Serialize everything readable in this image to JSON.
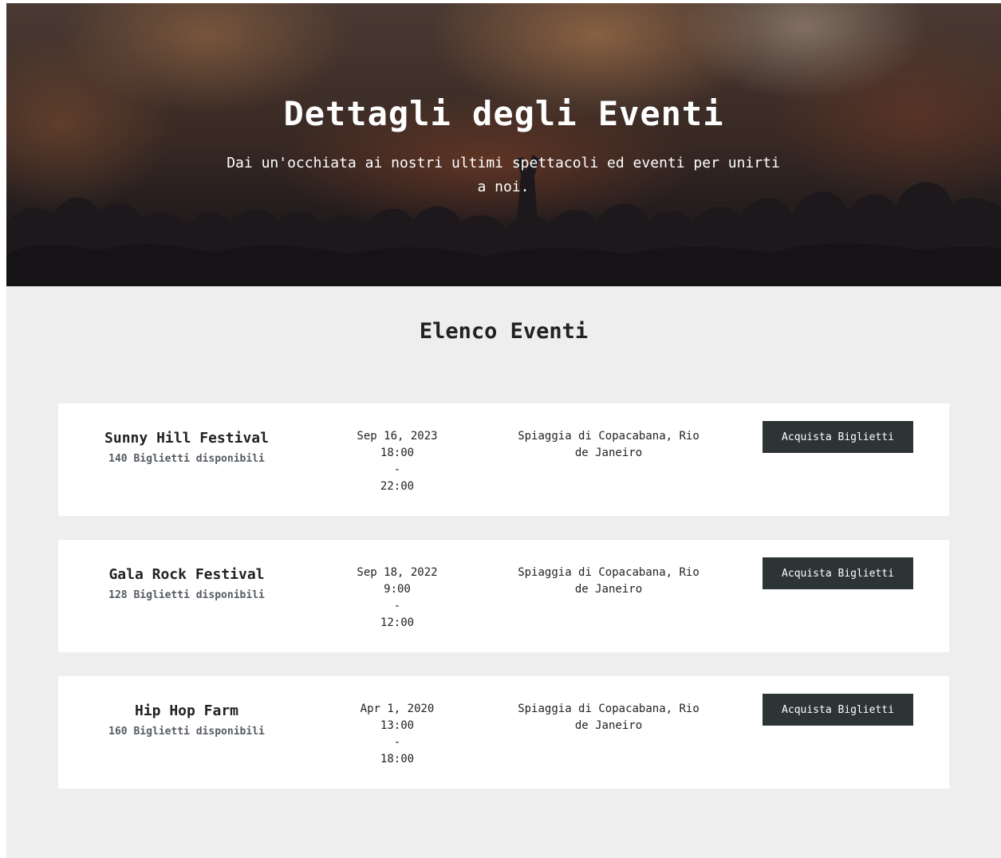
{
  "hero": {
    "title": "Dettagli degli Eventi",
    "subtitle": "Dai un'occhiata ai nostri ultimi spettacoli ed eventi per unirti a noi."
  },
  "events_section": {
    "title": "Elenco Eventi"
  },
  "events": [
    {
      "name": "Sunny Hill Festival",
      "tickets": "140 Biglietti disponibili",
      "date": "Sep 16, 2023",
      "start": "18:00",
      "separator": "-",
      "end": "22:00",
      "location": "Spiaggia di Copacabana, Rio de Janeiro",
      "button_label": "Acquista Biglietti"
    },
    {
      "name": "Gala Rock Festival",
      "tickets": "128 Biglietti disponibili",
      "date": "Sep 18, 2022",
      "start": "9:00",
      "separator": "-",
      "end": "12:00",
      "location": "Spiaggia di Copacabana, Rio de Janeiro",
      "button_label": "Acquista Biglietti"
    },
    {
      "name": "Hip Hop Farm",
      "tickets": "160 Biglietti disponibili",
      "date": "Apr 1, 2020",
      "start": "13:00",
      "separator": "-",
      "end": "18:00",
      "location": "Spiaggia di Copacabana, Rio de Janeiro",
      "button_label": "Acquista Biglietti"
    }
  ],
  "colors": {
    "page_background": "#eeeeee",
    "card_background": "#ffffff",
    "button_background": "#2d3436",
    "button_text": "#ffffff",
    "tickets_text": "#555a60"
  }
}
